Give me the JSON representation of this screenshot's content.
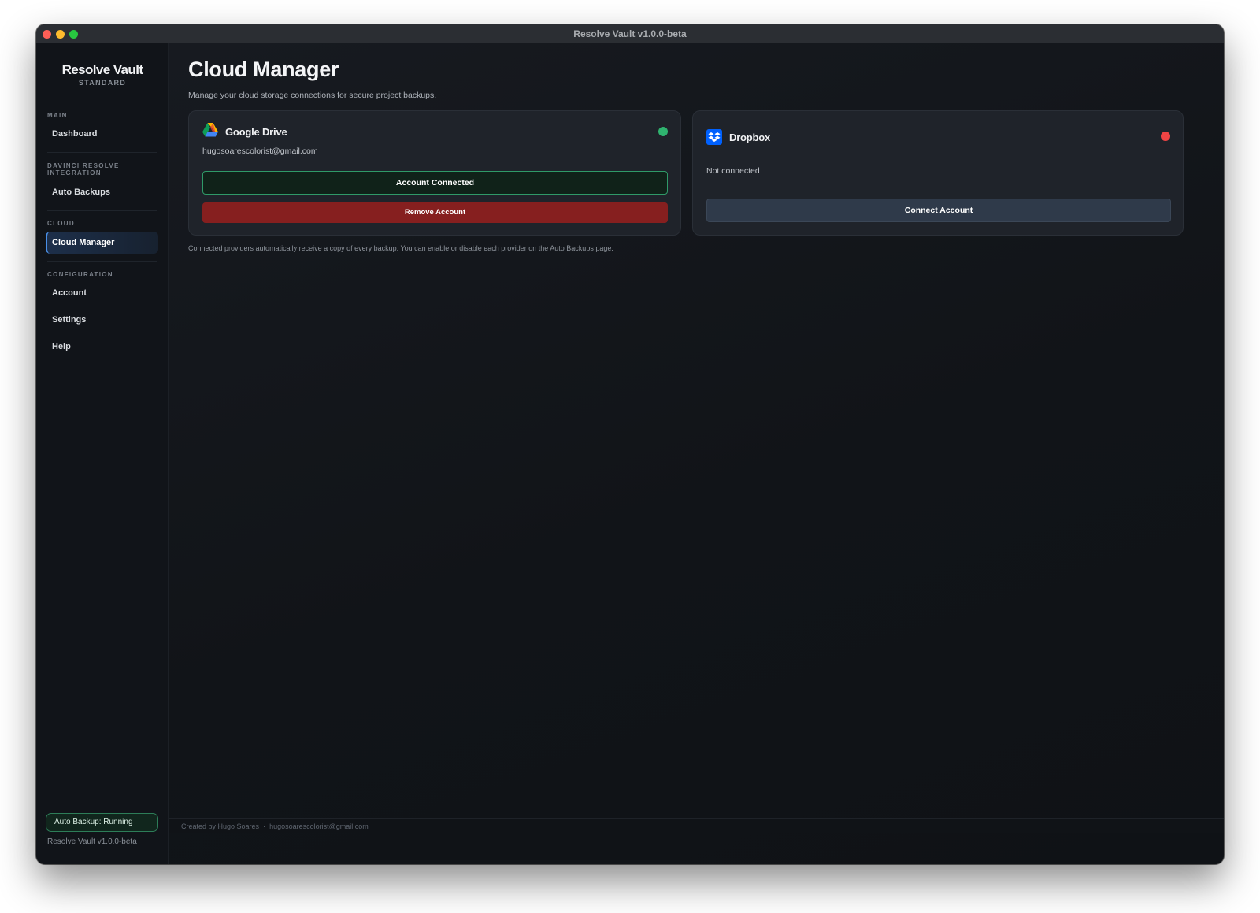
{
  "window": {
    "title": "Resolve Vault v1.0.0-beta"
  },
  "sidebar": {
    "brand": "Resolve Vault",
    "edition": "STANDARD",
    "sections": [
      {
        "label": "MAIN",
        "items": [
          {
            "label": "Dashboard"
          }
        ]
      },
      {
        "label": "DAVINCI RESOLVE INTEGRATION",
        "items": [
          {
            "label": "Auto Backups"
          }
        ]
      },
      {
        "label": "CLOUD",
        "items": [
          {
            "label": "Cloud Manager",
            "active": true
          }
        ]
      },
      {
        "label": "CONFIGURATION",
        "items": [
          {
            "label": "Account"
          },
          {
            "label": "Settings"
          },
          {
            "label": "Help"
          }
        ]
      }
    ],
    "status_badge": "Auto Backup: Running",
    "version": "Resolve Vault v1.0.0-beta"
  },
  "main": {
    "title": "Cloud Manager",
    "subtitle": "Manage your cloud storage connections for secure project backups.",
    "providers": [
      {
        "name": "Google Drive",
        "icon": "google-drive-icon",
        "email": "hugosoarescolorist@gmail.com",
        "status": "connected",
        "status_color": "#2fb36f",
        "connected_label": "Account Connected",
        "remove_label": "Remove Account"
      },
      {
        "name": "Dropbox",
        "icon": "dropbox-icon",
        "status_text": "Not connected",
        "status": "disconnected",
        "status_color": "#ef4444",
        "connect_label": "Connect Account"
      }
    ],
    "footnote": "Connected providers automatically receive a copy of every backup. You can enable or disable each provider on the Auto Backups page."
  },
  "footer": {
    "created_by": "Created by Hugo Soares",
    "separator": "·",
    "email": "hugosoarescolorist@gmail.com"
  },
  "colors": {
    "accent": "#4a8fe7",
    "success": "#2fb36f",
    "danger": "#861f1f",
    "dropbox_blue": "#0061fe"
  }
}
